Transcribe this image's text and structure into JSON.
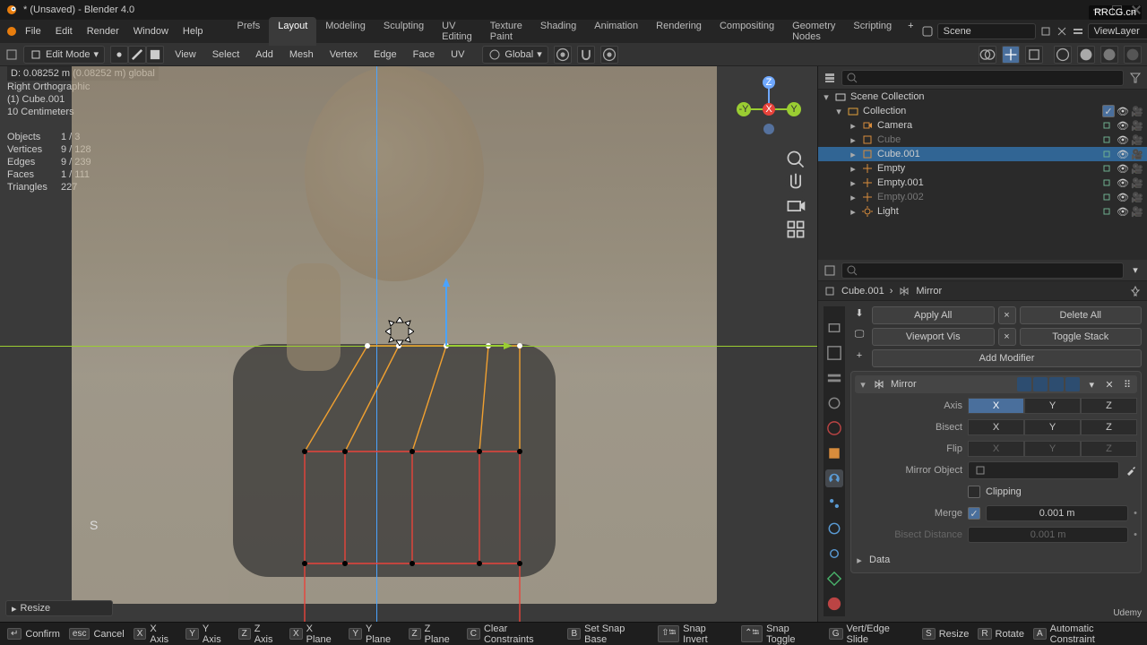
{
  "app": {
    "title": "* (Unsaved) - Blender 4.0",
    "blender_icon": "blender-logo"
  },
  "menus": [
    "File",
    "Edit",
    "Render",
    "Window",
    "Help"
  ],
  "workspaces": [
    "Prefs",
    "Layout",
    "Modeling",
    "Sculpting",
    "UV Editing",
    "Texture Paint",
    "Shading",
    "Animation",
    "Rendering",
    "Compositing",
    "Geometry Nodes",
    "Scripting"
  ],
  "active_workspace": "Layout",
  "scene_field": "Scene",
  "viewlayer_field": "ViewLayer",
  "header2": {
    "mode": "Edit Mode",
    "menus": [
      "View",
      "Select",
      "Add",
      "Mesh",
      "Vertex",
      "Edge",
      "Face",
      "UV"
    ],
    "orientation": "Global"
  },
  "vp_info": "D: 0.08252 m  (0.08252 m) global",
  "vp_top": {
    "view": "Right Orthographic",
    "obj": "(1) Cube.001",
    "scale": "10 Centimeters"
  },
  "vp_stats": [
    {
      "k": "Objects",
      "v": "1 / 3"
    },
    {
      "k": "Vertices",
      "v": "9 / 128"
    },
    {
      "k": "Edges",
      "v": "9 / 239"
    },
    {
      "k": "Faces",
      "v": "1 / 111"
    },
    {
      "k": "Triangles",
      "v": "227"
    }
  ],
  "resize_label": "Resize",
  "s_key": "S",
  "outliner": {
    "root": "Scene Collection",
    "collection": "Collection",
    "items": [
      {
        "name": "Camera",
        "dim": false
      },
      {
        "name": "Cube",
        "dim": true
      },
      {
        "name": "Cube.001",
        "sel": true
      },
      {
        "name": "Empty",
        "dim": false
      },
      {
        "name": "Empty.001",
        "dim": false
      },
      {
        "name": "Empty.002",
        "dim": true
      },
      {
        "name": "Light",
        "dim": false
      }
    ]
  },
  "props_path": {
    "obj": "Cube.001",
    "mod": "Mirror"
  },
  "mod_actions": {
    "apply": "Apply All",
    "delX": "×",
    "delAll": "Delete All",
    "viewport": "Viewport Vis",
    "toggle": "Toggle Stack",
    "add": "Add Modifier"
  },
  "mirror": {
    "name": "Mirror",
    "axis_label": "Axis",
    "bisect_label": "Bisect",
    "flip_label": "Flip",
    "axes": [
      "X",
      "Y",
      "Z"
    ],
    "axis_active": "X",
    "mirror_object_label": "Mirror Object",
    "clipping_label": "Clipping",
    "merge_label": "Merge",
    "merge_val": "0.001 m",
    "bisect_dist_label": "Bisect Distance",
    "bisect_dist_val": "0.001 m",
    "data_label": "Data"
  },
  "status": [
    {
      "key": "↵",
      "label": "Confirm"
    },
    {
      "key": "esc",
      "label": "Cancel"
    },
    {
      "key": "X",
      "label": "X Axis"
    },
    {
      "key": "Y",
      "label": "Y Axis"
    },
    {
      "key": "Z",
      "label": "Z Axis"
    },
    {
      "key": "X",
      "label": "X Plane"
    },
    {
      "key": "Y",
      "label": "Y Plane"
    },
    {
      "key": "Z",
      "label": "Z Plane"
    },
    {
      "key": "C",
      "label": "Clear Constraints"
    },
    {
      "key": "B",
      "label": "Set Snap Base"
    },
    {
      "key": "⇧⭾",
      "label": "Snap Invert"
    },
    {
      "key": "⌃⭾",
      "label": "Snap Toggle"
    },
    {
      "key": "G",
      "label": "Vert/Edge Slide"
    },
    {
      "key": "S",
      "label": "Resize"
    },
    {
      "key": "R",
      "label": "Rotate"
    },
    {
      "key": "A",
      "label": "Automatic Constraint"
    }
  ],
  "watermark_top": "RRCG.cn",
  "watermark_bot": "Udemy"
}
